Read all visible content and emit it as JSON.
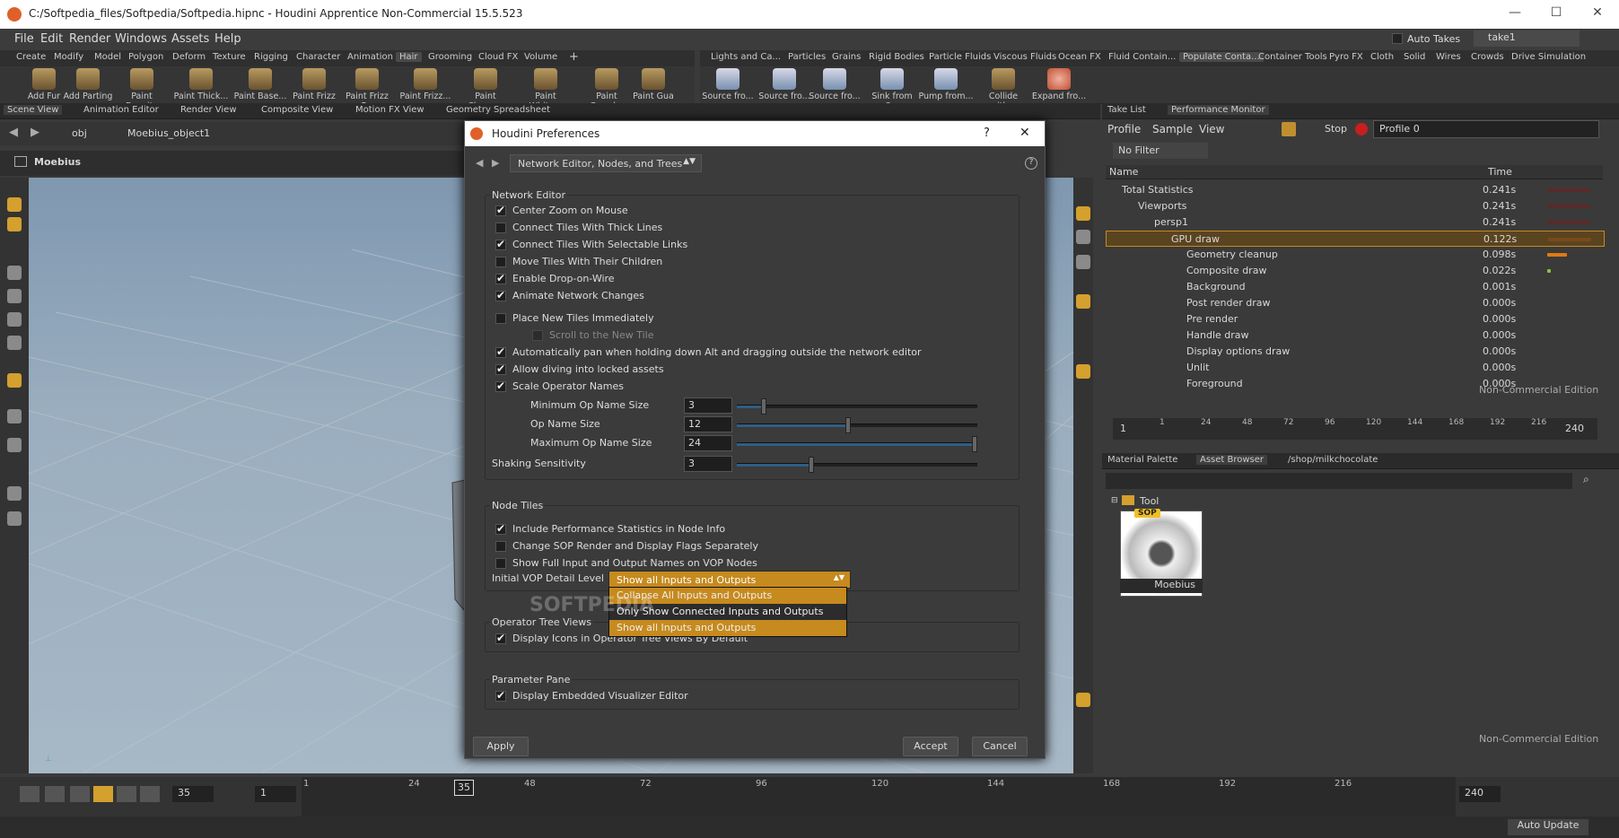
{
  "window": {
    "title": "C:/Softpedia_files/Softpedia/Softpedia.hipnc - Houdini Apprentice Non-Commercial 15.5.523",
    "min": "—",
    "max": "☐",
    "close": "✕"
  },
  "menu": [
    "File",
    "Edit",
    "Render",
    "Windows",
    "Assets",
    "Help"
  ],
  "takes": {
    "auto_label": "Auto Takes",
    "current": "take1"
  },
  "shelf_left": {
    "tabs": [
      "Create",
      "Modify",
      "Model",
      "Polygon",
      "Deform",
      "Texture",
      "Rigging",
      "Character",
      "Animation",
      "Hair",
      "Grooming",
      "Cloud FX",
      "Volume"
    ],
    "active": "Hair",
    "add": "+",
    "tools": [
      "Add Fur",
      "Add Parting",
      "Paint Density",
      "Paint Thick...",
      "Paint Base...",
      "Paint Frizz",
      "Paint Frizz F...",
      "Paint Frizz...",
      "Paint Clump...",
      "Paint White...",
      "Paint Guard...",
      "Paint Gua"
    ]
  },
  "shelf_right": {
    "tabs": [
      "Lights and Ca...",
      "Particles",
      "Grains",
      "Rigid Bodies",
      "Particle Fluids",
      "Viscous Fluids",
      "Ocean FX",
      "Fluid Contain...",
      "Populate Conta...",
      "Container Tools",
      "Pyro FX",
      "Cloth",
      "Solid",
      "Wires",
      "Crowds",
      "Drive Simulation"
    ],
    "active": "Populate Conta...",
    "tools": [
      "Source fro...",
      "Source fro...",
      "Source fro...",
      "Sink from O...",
      "Pump from...",
      "Collide with...",
      "Expand fro..."
    ]
  },
  "left_tabs": [
    "Scene View",
    "Animation Editor",
    "Render View",
    "Composite View",
    "Motion FX View",
    "Geometry Spreadsheet"
  ],
  "path": {
    "root": "obj",
    "node": "Moebius_object1"
  },
  "viewport": {
    "name": "Moebius"
  },
  "dialog": {
    "title": "Houdini Preferences",
    "help": "?",
    "close": "✕",
    "category": "Network Editor, Nodes, and Trees",
    "sec_network": "Network Editor",
    "net_opts": [
      {
        "label": "Center Zoom on Mouse",
        "on": true
      },
      {
        "label": "Connect Tiles With Thick Lines",
        "on": false
      },
      {
        "label": "Connect Tiles With Selectable Links",
        "on": true
      },
      {
        "label": "Move Tiles With Their Children",
        "on": false
      },
      {
        "label": "Enable Drop-on-Wire",
        "on": true
      },
      {
        "label": "Animate Network Changes",
        "on": true
      },
      {
        "label": "Place New Tiles Immediately",
        "on": false
      },
      {
        "label": "Scroll to the New Tile",
        "on": false
      },
      {
        "label": "Automatically pan when holding down Alt and dragging outside the network editor",
        "on": true
      },
      {
        "label": "Allow diving into locked assets",
        "on": true
      },
      {
        "label": "Scale Operator Names",
        "on": true
      }
    ],
    "min_op": {
      "label": "Minimum Op Name Size",
      "value": "3",
      "level": 0.1
    },
    "op": {
      "label": "Op Name Size",
      "value": "12",
      "level": 0.45
    },
    "max_op": {
      "label": "Maximum Op Name Size",
      "value": "24",
      "level": 1.0
    },
    "shaking": {
      "label": "Shaking Sensitivity",
      "value": "3",
      "level": 0.3
    },
    "sec_tiles": "Node Tiles",
    "tile_opts": [
      {
        "label": "Include Performance Statistics in Node Info",
        "on": true
      },
      {
        "label": "Change SOP Render and Display Flags Separately",
        "on": false
      },
      {
        "label": "Show Full Input and Output Names on VOP Nodes",
        "on": false
      }
    ],
    "vop_label": "Initial VOP Detail Level",
    "vop_value": "Show all Inputs and Outputs",
    "vop_options": [
      "Collapse All Inputs and Outputs",
      "Only Show Connected Inputs and Outputs",
      "Show all Inputs and Outputs"
    ],
    "sec_tree": "Operator Tree Views",
    "tree_opt": {
      "label": "Display Icons in Operator Tree Views By Default",
      "on": true
    },
    "sec_param": "Parameter Pane",
    "param_opt": {
      "label": "Display Embedded Visualizer Editor",
      "on": true
    },
    "apply": "Apply",
    "accept": "Accept",
    "cancel": "Cancel"
  },
  "perf": {
    "tabs": [
      "Take List",
      "Performance Monitor"
    ],
    "menu": [
      "Profile",
      "Sample",
      "View"
    ],
    "stop": "Stop",
    "profile": "Profile 0",
    "filter": "No Filter",
    "col_name": "Name",
    "col_time": "Time",
    "rows": [
      {
        "name": "Total Statistics",
        "time": "0.241s",
        "indent": 0,
        "bar": 0,
        "color": "#5a2a2a"
      },
      {
        "name": "Viewports",
        "time": "0.241s",
        "indent": 1,
        "bar": 0,
        "color": "#5a2a2a"
      },
      {
        "name": "persp1",
        "time": "0.241s",
        "indent": 2,
        "bar": 0,
        "color": "#5a2a2a"
      },
      {
        "name": "GPU draw",
        "time": "0.122s",
        "indent": 3,
        "bar": 0,
        "color": "#7a4a1a",
        "sel": true
      },
      {
        "name": "Geometry cleanup",
        "time": "0.098s",
        "indent": 4,
        "bar": 1,
        "color": "#e07a10"
      },
      {
        "name": "Composite draw",
        "time": "0.022s",
        "indent": 4,
        "bar": 0.2,
        "color": "#8ac040"
      },
      {
        "name": "Background",
        "time": "0.001s",
        "indent": 4,
        "bar": 0,
        "color": "#444"
      },
      {
        "name": "Post render draw",
        "time": "0.000s",
        "indent": 4,
        "bar": 0,
        "color": "#444"
      },
      {
        "name": "Pre render",
        "time": "0.000s",
        "indent": 4,
        "bar": 0,
        "color": "#444"
      },
      {
        "name": "Handle draw",
        "time": "0.000s",
        "indent": 4,
        "bar": 0,
        "color": "#444"
      },
      {
        "name": "Display options draw",
        "time": "0.000s",
        "indent": 4,
        "bar": 0,
        "color": "#444"
      },
      {
        "name": "Unlit",
        "time": "0.000s",
        "indent": 4,
        "bar": 0,
        "color": "#444"
      },
      {
        "name": "Foreground",
        "time": "0.000s",
        "indent": 4,
        "bar": 0,
        "color": "#444"
      }
    ],
    "watermark": "Non-Commercial Edition",
    "mini_start": "1",
    "mini_end": "240",
    "mini_ticks": [
      "1",
      "24",
      "48",
      "72",
      "96",
      "120",
      "144",
      "168",
      "192",
      "216"
    ]
  },
  "assets": {
    "tabs": [
      "Material Palette",
      "Asset Browser",
      "/shop/milkchocolate"
    ],
    "folder": "Tool",
    "badge": "SOP",
    "item": "Moebius",
    "watermark": "Non-Commercial Edition"
  },
  "timeline": {
    "frame": "35",
    "start": "1",
    "end": "240",
    "current": "35",
    "ticks": [
      "1",
      "24",
      "48",
      "72",
      "96",
      "120",
      "144",
      "168",
      "192",
      "216"
    ],
    "auto_update": "Auto Update"
  },
  "overlay_text": "SOFTPEDIA"
}
